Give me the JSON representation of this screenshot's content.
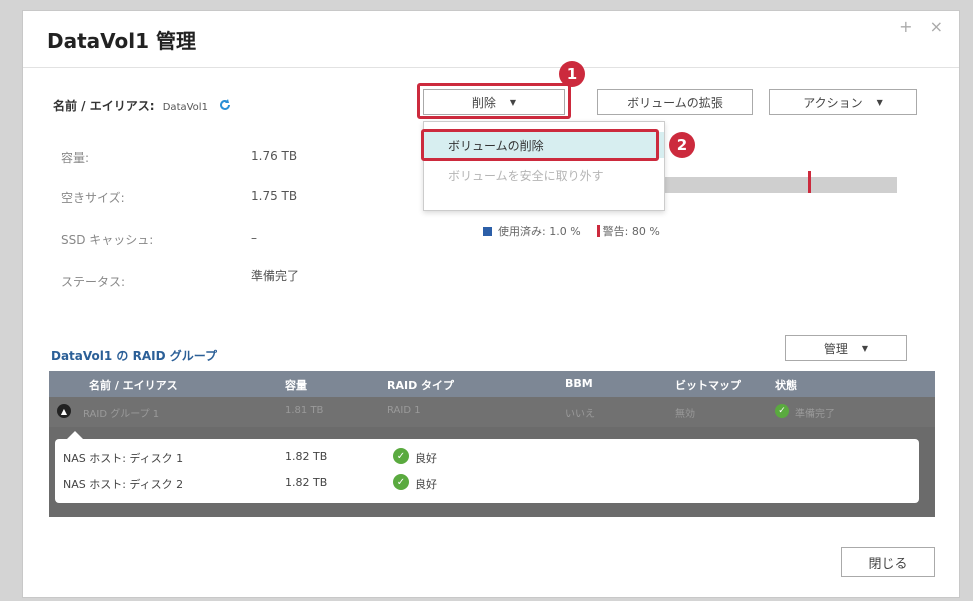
{
  "dialog": {
    "title": "DataVol1 管理",
    "window_controls": "+ ×"
  },
  "volume": {
    "name_label": "名前 / エイリアス:",
    "name_value": "DataVol1",
    "info": [
      {
        "label": "容量:",
        "value": "1.76 TB"
      },
      {
        "label": "空きサイズ:",
        "value": "1.75 TB"
      },
      {
        "label": "SSD キャッシュ:",
        "value": "–"
      },
      {
        "label": "ステータス:",
        "value": "準備完了"
      }
    ],
    "usage": {
      "used_label": "使用済み: 1.0 %",
      "warn_label": "警告: 80 %",
      "used_fraction": 0.01,
      "warn_fraction": 0.8
    }
  },
  "toolbar": {
    "delete_label": "削除",
    "expand_label": "ボリュームの拡張",
    "action_label": "アクション",
    "manage_label": "管理",
    "close_label": "閉じる"
  },
  "dropdown": {
    "items": [
      "ボリュームの削除",
      "ボリュームを安全に取り外す"
    ]
  },
  "badges": [
    "1",
    "2"
  ],
  "raid": {
    "title": "DataVol1 の RAID グループ",
    "columns": [
      "名前 / エイリアス",
      "容量",
      "RAID タイプ",
      "BBM",
      "ビットマップ",
      "状態"
    ],
    "group": {
      "name": "RAID グループ 1",
      "capacity": "1.81 TB",
      "raid_type": "RAID 1",
      "bbm": "いいえ",
      "bitmap": "無効",
      "status": "準備完了"
    },
    "disks": [
      {
        "name": "NAS ホスト: ディスク 1",
        "capacity": "1.82 TB",
        "status": "良好"
      },
      {
        "name": "NAS ホスト: ディスク 2",
        "capacity": "1.82 TB",
        "status": "良好"
      }
    ]
  },
  "colors": {
    "accent_red": "#cc2a3d",
    "ok_green": "#5aaa3f",
    "link_blue": "#2b5f97"
  }
}
